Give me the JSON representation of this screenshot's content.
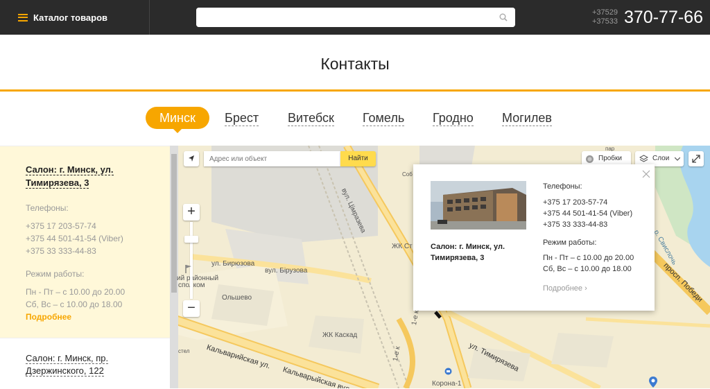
{
  "header": {
    "catalog_label": "Каталог товаров",
    "search_placeholder": "",
    "phone_codes": [
      "+37529",
      "+37533"
    ],
    "phone_main": "370-77-66"
  },
  "page_title": "Контакты",
  "cities": [
    {
      "label": "Минск",
      "active": true
    },
    {
      "label": "Брест",
      "active": false
    },
    {
      "label": "Витебск",
      "active": false
    },
    {
      "label": "Гомель",
      "active": false
    },
    {
      "label": "Гродно",
      "active": false
    },
    {
      "label": "Могилев",
      "active": false
    }
  ],
  "salons": [
    {
      "title": "Салон: г. Минск, ул. Тимирязева, 3",
      "phones_label": "Телефоны:",
      "phones": [
        "+375 17 203-57-74",
        "+375 44 501-41-54 (Viber)",
        "+375 33 333-44-83"
      ],
      "hours_label": "Режим работы:",
      "hours": [
        "Пн - Пт – с 10.00 до 20.00",
        "Сб, Вс – с 10.00 до 18.00"
      ],
      "more_label": "Подробнее"
    },
    {
      "title": "Салон: г. Минск, пр. Дзержинского, 122"
    }
  ],
  "map": {
    "address_placeholder": "Адрес или объект",
    "find_label": "Найти",
    "traffic_label": "Пробки",
    "layers_label": "Слои",
    "labels": {
      "street1": "ул. Бирюзова",
      "street2": "вул. Бірузова",
      "street3": "вул. Цімразева",
      "street4": "Кальварийская ул.",
      "street5": "Кальварыйская вул.",
      "street6": "ул. Тимирязева",
      "street7": "просп. Победи",
      "street8": "р. Свислочь",
      "district": "Ольшево",
      "hospital1": "ий районный",
      "hospital2": "сполком",
      "complex": "ЖК Каскад",
      "store": "Корона-1",
      "jk": "ЖК Ст",
      "sob": "Соб",
      "stl": "стел",
      "road1": "1-е к",
      "road2": "1-е ко",
      "park": "пар"
    }
  },
  "balloon": {
    "salon_title": "Салон: г. Минск, ул. Тимирязева, 3",
    "phones_label": "Телефоны:",
    "phones": [
      "+375 17 203-57-74",
      "+375 44 501-41-54 (Viber)",
      "+375 33 333-44-83"
    ],
    "hours_label": "Режим работы:",
    "hours": [
      "Пн - Пт – с 10.00 до 20.00",
      "Сб, Вс – с 10.00 до 18.00"
    ],
    "more_label": "Подробнее ›"
  },
  "colors": {
    "accent": "#f7a600",
    "header_bg": "#2b2b2b",
    "panel_bg": "#fff8d9",
    "find_button": "#ffdb4d"
  }
}
